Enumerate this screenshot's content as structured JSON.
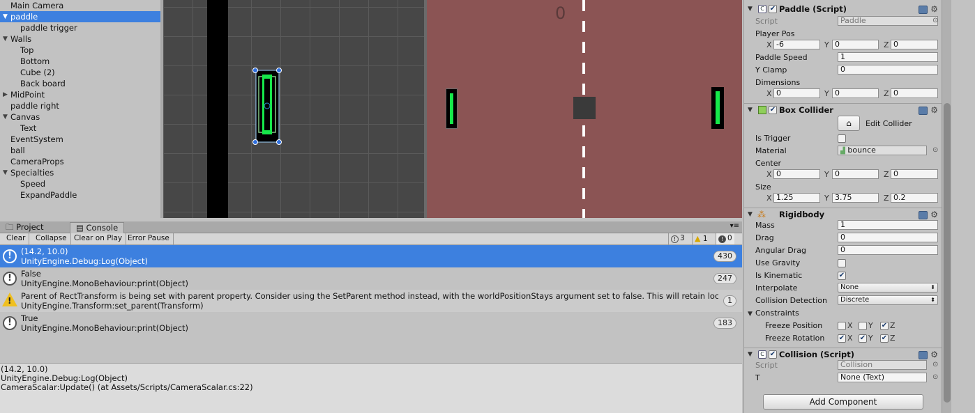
{
  "hierarchy": {
    "items": [
      {
        "label": "Main Camera",
        "arrow": ""
      },
      {
        "label": "paddle",
        "arrow": "▼"
      },
      {
        "label": "paddle trigger",
        "arrow": ""
      },
      {
        "label": "Walls",
        "arrow": "▼"
      },
      {
        "label": "Top",
        "arrow": ""
      },
      {
        "label": "Bottom",
        "arrow": ""
      },
      {
        "label": "Cube (2)",
        "arrow": ""
      },
      {
        "label": "Back board",
        "arrow": ""
      },
      {
        "label": "MidPoint",
        "arrow": "▶"
      },
      {
        "label": "paddle right",
        "arrow": ""
      },
      {
        "label": "Canvas",
        "arrow": "▼"
      },
      {
        "label": "Text",
        "arrow": ""
      },
      {
        "label": "EventSystem",
        "arrow": ""
      },
      {
        "label": "ball",
        "arrow": ""
      },
      {
        "label": "CameraProps",
        "arrow": ""
      },
      {
        "label": "Specialties",
        "arrow": "▼"
      },
      {
        "label": "Speed",
        "arrow": ""
      },
      {
        "label": "ExpandPaddle",
        "arrow": ""
      }
    ]
  },
  "game": {
    "score": "0"
  },
  "inspector": {
    "paddle_script": {
      "title": "Paddle (Script)",
      "script_label": "Script",
      "script_value": "Paddle",
      "player_pos_label": "Player Pos",
      "player_pos": {
        "x": "-6",
        "y": "0",
        "z": "0"
      },
      "paddle_speed_label": "Paddle Speed",
      "paddle_speed": "1",
      "y_clamp_label": "Y Clamp",
      "y_clamp": "0",
      "dimensions_label": "Dimensions",
      "dimensions": {
        "x": "0",
        "y": "0",
        "z": "0"
      }
    },
    "box_collider": {
      "title": "Box Collider",
      "edit_collider": "Edit Collider",
      "is_trigger_label": "Is Trigger",
      "material_label": "Material",
      "material": "bounce",
      "center_label": "Center",
      "center": {
        "x": "0",
        "y": "0",
        "z": "0"
      },
      "size_label": "Size",
      "size": {
        "x": "1.25",
        "y": "3.75",
        "z": "0.2"
      }
    },
    "rigidbody": {
      "title": "Rigidbody",
      "mass_label": "Mass",
      "mass": "1",
      "drag_label": "Drag",
      "drag": "0",
      "angular_drag_label": "Angular Drag",
      "angular_drag": "0",
      "use_gravity_label": "Use Gravity",
      "use_gravity": false,
      "is_kinematic_label": "Is Kinematic",
      "is_kinematic": true,
      "interpolate_label": "Interpolate",
      "interpolate": "None",
      "collision_detection_label": "Collision Detection",
      "collision_detection": "Discrete",
      "constraints_label": "Constraints",
      "freeze_position_label": "Freeze Position",
      "freeze_position": {
        "x": false,
        "y": false,
        "z": true
      },
      "freeze_rotation_label": "Freeze Rotation",
      "freeze_rotation": {
        "x": true,
        "y": true,
        "z": true
      }
    },
    "collision_script": {
      "title": "Collision (Script)",
      "script_label": "Script",
      "script_value": "Collision",
      "t_label": "T",
      "t_value": "None (Text)"
    },
    "add_component": "Add Component",
    "axis": {
      "x": "X",
      "y": "Y",
      "z": "Z"
    }
  },
  "console": {
    "tabs": {
      "project": "Project",
      "console": "Console"
    },
    "toolbar": {
      "clear": "Clear",
      "collapse": "Collapse",
      "clear_on_play": "Clear on Play",
      "error_pause": "Error Pause"
    },
    "counts": {
      "info": "3",
      "warn": "1",
      "error": "0"
    },
    "logs": [
      {
        "line1": "(14.2, 10.0)",
        "line2": "UnityEngine.Debug:Log(Object)",
        "count": "430",
        "type": "info"
      },
      {
        "line1": "False",
        "line2": "UnityEngine.MonoBehaviour:print(Object)",
        "count": "247",
        "type": "info"
      },
      {
        "line1": "Parent of RectTransform is being set with parent property. Consider using the SetParent method instead, with the worldPositionStays argument set to false. This will retain local orie",
        "line2": "UnityEngine.Transform:set_parent(Transform)",
        "count": "1",
        "type": "warn"
      },
      {
        "line1": "True",
        "line2": "UnityEngine.MonoBehaviour:print(Object)",
        "count": "183",
        "type": "info"
      }
    ],
    "detail": [
      "(14.2, 10.0)",
      "UnityEngine.Debug:Log(Object)",
      "CameraScalar:Update() (at Assets/Scripts/CameraScalar.cs:22)"
    ]
  }
}
